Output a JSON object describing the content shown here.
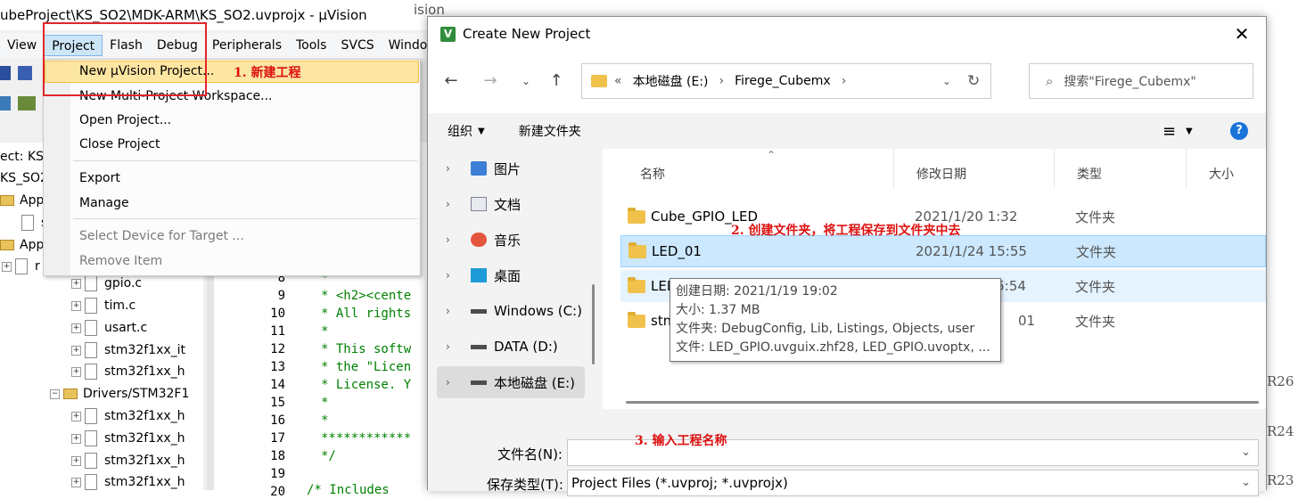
{
  "uvision": {
    "title": "ubeProject\\KS_SO2\\MDK-ARM\\KS_SO2.uvprojx - µVision",
    "bg_title_tail": "ision",
    "menubar": [
      "View",
      "Project",
      "Flash",
      "Debug",
      "Peripherals",
      "Tools",
      "SVCS",
      "Windo"
    ],
    "project_menu": {
      "items": [
        "New µVision Project...",
        "New Multi-Project Workspace...",
        "Open Project...",
        "Close Project",
        "Export",
        "Manage",
        "Select Device for Target ...",
        "Remove Item"
      ]
    },
    "tree": {
      "rows": [
        "ect: KS_S",
        "KS_SO2",
        "Appl",
        "s",
        "Appl",
        "r",
        "gpio.c",
        "tim.c",
        "usart.c",
        "stm32f1xx_it",
        "stm32f1xx_h",
        "Drivers/STM32F1",
        "stm32f1xx_h",
        "stm32f1xx_h",
        "stm32f1xx_h",
        "stm32f1xx_h"
      ]
    },
    "editor": {
      "line_numbers": [
        "8",
        "9",
        "10",
        "11",
        "12",
        "13",
        "14",
        "15",
        "16",
        "17",
        "18",
        "19",
        "20"
      ],
      "code": [
        "*",
        "* <h2><cente",
        "* All rights",
        "*",
        "* This softw",
        "* the \"Licen",
        "* License. Y",
        "*",
        "*",
        "************",
        "*/",
        "",
        "/* Includes"
      ]
    }
  },
  "annotations": {
    "step1": "1. 新建工程",
    "step2": "2. 创建文件夹，将工程保存到文件夹中去",
    "step3": "3. 输入工程名称"
  },
  "dialog": {
    "title": "Create New Project",
    "close_glyph": "✕",
    "address": {
      "prefix": "«",
      "segments": [
        "本地磁盘 (E:)",
        "Firege_Cubemx"
      ]
    },
    "search_placeholder": "搜索\"Firege_Cubemx\"",
    "cmdbar": {
      "organize": "组织",
      "new_folder": "新建文件夹",
      "help": "?"
    },
    "nav": [
      "图片",
      "文档",
      "音乐",
      "桌面",
      "Windows (C:)",
      "DATA (D:)",
      "本地磁盘 (E:)"
    ],
    "columns": {
      "name": "名称",
      "date": "修改日期",
      "type": "类型",
      "size": "大小"
    },
    "files": [
      {
        "name": "Cube_GPIO_LED",
        "date": "2021/1/20 1:32",
        "type": "文件夹"
      },
      {
        "name": "LED_01",
        "date": "2021/1/24 15:55",
        "type": "文件夹"
      },
      {
        "name": "LED_GPIO",
        "date": "2021/1/25 15:54",
        "type": "文件夹"
      },
      {
        "name": "stm",
        "date": "01",
        "type": "文件夹"
      }
    ],
    "tooltip": [
      "创建日期: 2021/1/19 19:02",
      "大小: 1.37 MB",
      "文件夹: DebugConfig, Lib, Listings, Objects, user",
      "文件: LED_GPIO.uvguix.zhf28, LED_GPIO.uvoptx, ..."
    ],
    "filename_label": "文件名(N):",
    "filename_value": "",
    "filetype_label": "保存类型(T):",
    "filetype_value": "Project Files (*.uvproj; *.uvprojx)"
  },
  "right_bg": {
    "labels": [
      "R26",
      "R24",
      "R23"
    ]
  }
}
